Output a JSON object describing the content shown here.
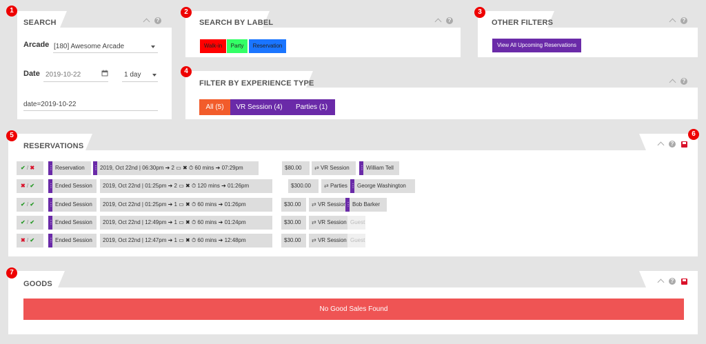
{
  "badges": [
    "1",
    "2",
    "3",
    "4",
    "5",
    "6",
    "7"
  ],
  "help_glyph": "?",
  "search": {
    "title": "SEARCH",
    "arcade_label": "Arcade",
    "arcade_value": "[180] Awesome Arcade",
    "date_label": "Date",
    "date_value": "2019-10-22",
    "period_value": "1 day",
    "query_value": "date=2019-10-22"
  },
  "search_by_label": {
    "title": "SEARCH BY LABEL",
    "labels": [
      {
        "text": "Walk-in",
        "color": "#ff0000"
      },
      {
        "text": "Party",
        "color": "#33ff66"
      },
      {
        "text": "Reservation",
        "color": "#1a75ff"
      }
    ]
  },
  "other_filters": {
    "title": "OTHER FILTERS",
    "button": "View All Upcoming Reservations",
    "button_color": "#6a2aa8"
  },
  "experience": {
    "title": "FILTER BY EXPERIENCE TYPE",
    "all": "All (5)",
    "vr": "VR Session (4)",
    "parties": "Parties (1)",
    "all_color": "#f25c2b",
    "other_color": "#6a2aa8"
  },
  "reservations": {
    "title": "RESERVATIONS",
    "rows": [
      {
        "status": [
          "check",
          "x"
        ],
        "type": "Reservation",
        "type_marked": true,
        "time": "2019, Oct 22nd | 06:30pm",
        "devices": "2",
        "duration": "60 mins",
        "end": "07:29pm",
        "time_marked": true,
        "price": "$80.00",
        "experience": "VR Session",
        "guest": "William Tell",
        "guest_marked": true
      },
      {
        "status": [
          "x",
          "check"
        ],
        "type": "Ended Session",
        "type_marked": true,
        "time": "2019, Oct 22nd | 01:25pm",
        "devices": "2",
        "duration": "120 mins",
        "end": "01:26pm",
        "time_marked": false,
        "price": "$300.00",
        "experience": "Parties",
        "guest": "George Washington",
        "guest_marked": true
      },
      {
        "status": [
          "check",
          "check"
        ],
        "type": "Ended Session",
        "type_marked": true,
        "time": "2019, Oct 22nd | 01:25pm",
        "devices": "1",
        "duration": "60 mins",
        "end": "01:26pm",
        "time_marked": false,
        "price": "$30.00",
        "experience": "VR Session",
        "guest": "Bob Barker",
        "guest_marked": true
      },
      {
        "status": [
          "check",
          "check"
        ],
        "type": "Ended Session",
        "type_marked": true,
        "time": "2019, Oct 22nd | 12:49pm",
        "devices": "1",
        "duration": "60 mins",
        "end": "01:24pm",
        "time_marked": false,
        "price": "$30.00",
        "experience": "VR Session",
        "guest": "Guest",
        "guest_marked": false
      },
      {
        "status": [
          "x",
          "check"
        ],
        "type": "Ended Session",
        "type_marked": true,
        "time": "2019, Oct 22nd | 12:47pm",
        "devices": "1",
        "duration": "60 mins",
        "end": "12:48pm",
        "time_marked": false,
        "price": "$30.00",
        "experience": "VR Session",
        "guest": "Guest",
        "guest_marked": false
      }
    ]
  },
  "goods": {
    "title": "GOODS",
    "empty_message": "No Good Sales Found"
  }
}
